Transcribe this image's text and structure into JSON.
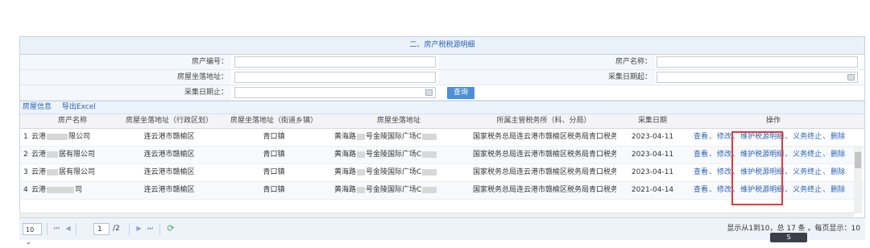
{
  "section_title": "二、房产税税源明细",
  "filters": {
    "house_id_label": "房产编号：",
    "house_name_label": "房产名称：",
    "address_label": "房屋坐落地址：",
    "collect_start_label": "采集日期起：",
    "collect_end_label": "采集日期止：",
    "query_button": "查询"
  },
  "toolbar": {
    "house_info": "房屋信息",
    "export_excel": "导出Excel"
  },
  "table": {
    "headers": [
      "房产名称",
      "房屋坐落地址（行政区划）",
      "房屋坐落地址（街道乡镇）",
      "房屋坐落地址",
      "所属主管税务所（科、分局）",
      "采集日期",
      "操作"
    ],
    "rows": [
      {
        "no": "1",
        "name_prefix": "云港",
        "name_suffix": "限公司",
        "district": "连云港市赣榆区",
        "town": "青口镇",
        "address_prefix": "黄海路",
        "address_mid": "号金陵国际广场C",
        "tax_office": "国家税务总局连云港市赣榆区税务局青口税务分局",
        "date": "2023-04-11"
      },
      {
        "no": "2",
        "name_prefix": "云港",
        "name_suffix": "居有限公司",
        "district": "连云港市赣榆区",
        "town": "青口镇",
        "address_prefix": "黄海路",
        "address_mid": "号金陵国际广场C",
        "tax_office": "国家税务总局连云港市赣榆区税务局青口税务分局",
        "date": "2023-04-11"
      },
      {
        "no": "3",
        "name_prefix": "云港",
        "name_suffix": "居有限公司",
        "district": "连云港市赣榆区",
        "town": "青口镇",
        "address_prefix": "黄海路",
        "address_mid": "号金陵国际广场C",
        "tax_office": "国家税务总局连云港市赣榆区税务局青口税务分局",
        "date": "2023-04-11"
      },
      {
        "no": "4",
        "name_prefix": "云港",
        "name_suffix": "司",
        "district": "连云港市赣榆区",
        "town": "青口镇",
        "address_prefix": "黄海路",
        "address_mid": "号金陵国际广场C",
        "tax_office": "国家税务总局连云港市赣榆区税务局青口税务分局",
        "date": "2021-04-14"
      }
    ],
    "ops": {
      "view": "查看",
      "edit": "修改",
      "maintain": "维护税源明细",
      "terminate": "义务终止",
      "delete": "删除",
      "sep": "、"
    }
  },
  "pager": {
    "page_size": "10",
    "current_page": "1",
    "total_pages": "/2",
    "info": "显示从1到10，总 17 条 。每页显示：10"
  },
  "badge": "S",
  "colors": {
    "accent": "#2a63b4",
    "highlight": "#e03a3a",
    "button": "#4d8fd6"
  }
}
